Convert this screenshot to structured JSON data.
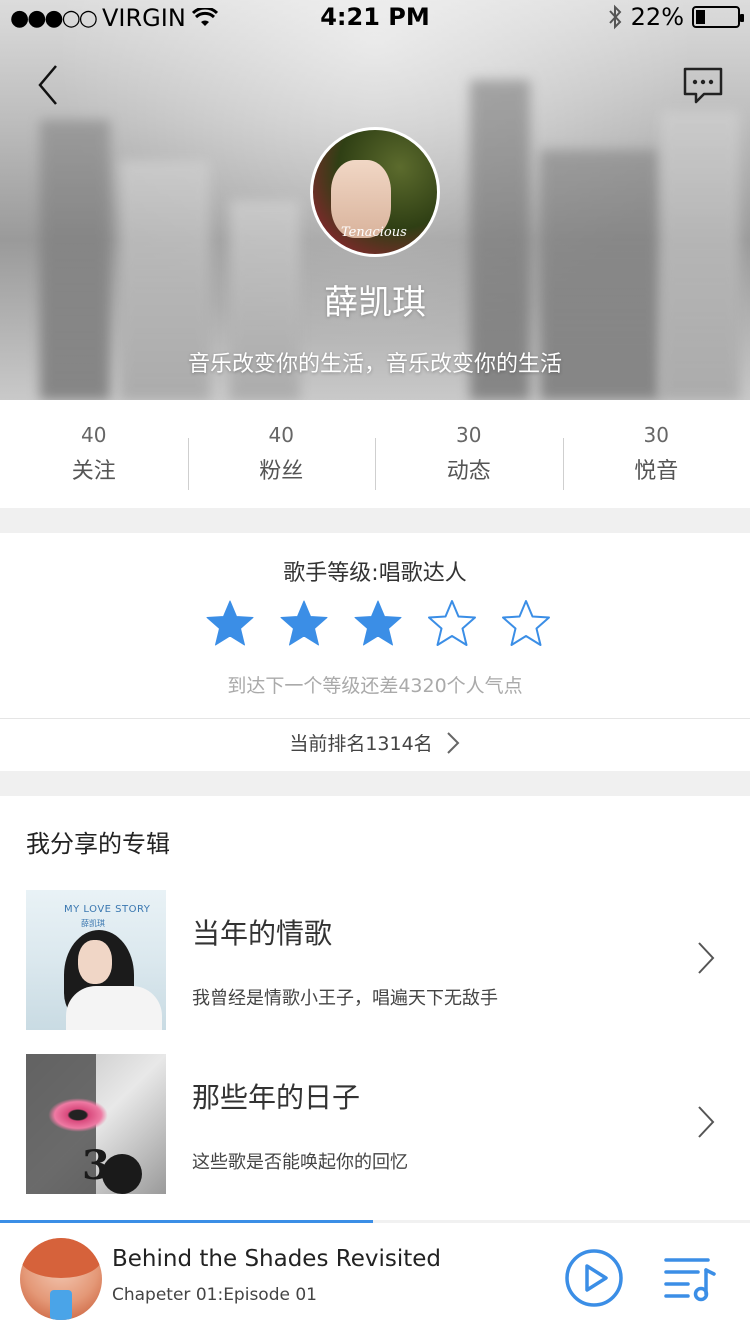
{
  "status_bar": {
    "signal_dots": "●●●○○",
    "carrier": "VIRGIN",
    "time": "4:21 PM",
    "battery_text": "22%",
    "battery_level": 0.22
  },
  "header": {
    "back_icon": "chevron-left-icon",
    "message_icon": "chat-bubble-icon",
    "avatar_caption": "Tenacious",
    "name": "薛凯琪",
    "bio": "音乐改变你的生活，音乐改变你的生活"
  },
  "stats": [
    {
      "value": "40",
      "label": "关注"
    },
    {
      "value": "40",
      "label": "粉丝"
    },
    {
      "value": "30",
      "label": "动态"
    },
    {
      "value": "30",
      "label": "悦音"
    }
  ],
  "level": {
    "title": "歌手等级:唱歌达人",
    "stars_filled": 3,
    "stars_total": 5,
    "star_color": "#3b8ee6",
    "hint": "到达下一个等级还差4320个人气点",
    "rank_text": "当前排名1314名"
  },
  "albums": {
    "section_title": "我分享的专辑",
    "items": [
      {
        "title": "当年的情歌",
        "desc": "我曾经是情歌小王子，唱遍天下无敌手",
        "cover_text": "MY LOVE STORY",
        "cover_sub": "薛凯琪"
      },
      {
        "title": "那些年的日子",
        "desc": "这些歌是否能唤起你的回忆",
        "cover_text": "3"
      }
    ]
  },
  "player": {
    "title": "Behind the Shades Revisited",
    "subtitle": "Chapeter 01:Episode 01",
    "progress": 0.497,
    "accent": "#3b8ee6"
  }
}
